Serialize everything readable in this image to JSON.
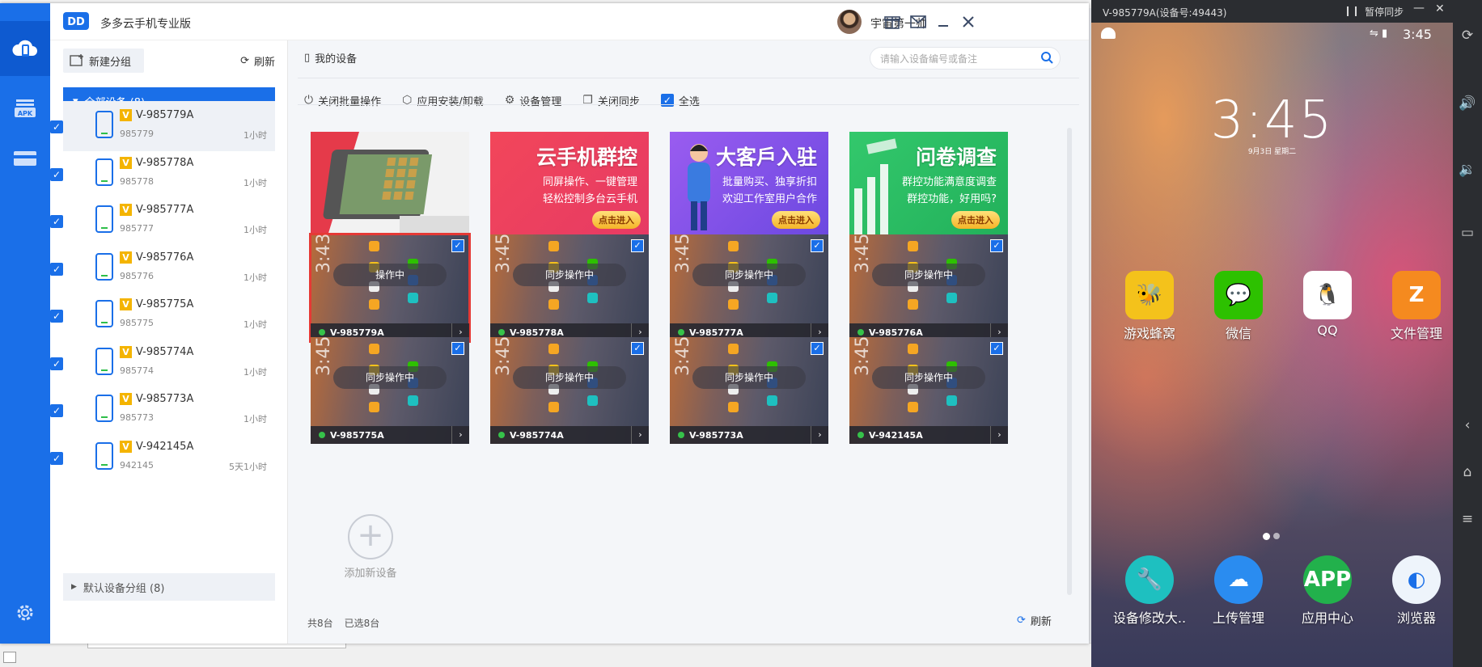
{
  "app": {
    "title": "多多云手机专业版",
    "user_name": "宇宙第一帅"
  },
  "groups": {
    "new_group_label": "新建分组",
    "refresh_label": "刷新",
    "all_devices_label": "全部设备 (8)",
    "default_group_label": "默认设备分组 (8)",
    "devices": [
      {
        "name": "V-985779A",
        "id": "985779",
        "time": "1小时"
      },
      {
        "name": "V-985778A",
        "id": "985778",
        "time": "1小时"
      },
      {
        "name": "V-985777A",
        "id": "985777",
        "time": "1小时"
      },
      {
        "name": "V-985776A",
        "id": "985776",
        "time": "1小时"
      },
      {
        "name": "V-985775A",
        "id": "985775",
        "time": "1小时"
      },
      {
        "name": "V-985774A",
        "id": "985774",
        "time": "1小时"
      },
      {
        "name": "V-985773A",
        "id": "985773",
        "time": "1小时"
      },
      {
        "name": "V-942145A",
        "id": "942145",
        "time": "5天1小时"
      }
    ],
    "badge": "V"
  },
  "main": {
    "header_label": "我的设备",
    "search_placeholder": "请输入设备编号或备注",
    "toolbar": {
      "close_batch": "关闭批量操作",
      "app_install": "应用安装/卸载",
      "device_manage": "设备管理",
      "close_sync": "关闭同步",
      "select_all": "全选"
    },
    "banners": [
      {
        "title": "",
        "sub1": "",
        "sub2": "",
        "button": ""
      },
      {
        "title": "云手机群控",
        "sub1": "同屏操作、一键管理",
        "sub2": "轻松控制多台云手机",
        "button": "点击进入"
      },
      {
        "title": "大客戶入驻",
        "sub1": "批量购买、独享折扣",
        "sub2": "欢迎工作室用户合作",
        "button": "点击进入"
      },
      {
        "title": "问卷调查",
        "sub1": "群控功能满意度调查",
        "sub2": "群控功能，好用吗?",
        "button": "点击进入"
      }
    ],
    "screens": [
      {
        "name": "V-985779A",
        "status": "操作中",
        "clock": "3:43"
      },
      {
        "name": "V-985778A",
        "status": "同步操作中",
        "clock": "3:45"
      },
      {
        "name": "V-985777A",
        "status": "同步操作中",
        "clock": "3:45"
      },
      {
        "name": "V-985776A",
        "status": "同步操作中",
        "clock": "3:45"
      },
      {
        "name": "V-985775A",
        "status": "同步操作中",
        "clock": "3:45"
      },
      {
        "name": "V-985774A",
        "status": "同步操作中",
        "clock": "3:45"
      },
      {
        "name": "V-985773A",
        "status": "同步操作中",
        "clock": "3:45"
      },
      {
        "name": "V-942145A",
        "status": "同步操作中",
        "clock": "3:45"
      }
    ],
    "add_device_label": "添加新设备",
    "footer_total": "共8台",
    "footer_selected": "已选8台",
    "footer_refresh": "刷新"
  },
  "preview": {
    "title": "V-985779A(设备号:49443)",
    "pause_label": "暂停同步",
    "status_time": "3:45",
    "clock": "3:45",
    "date": "9月3日 星期二",
    "apps_row1": [
      {
        "label": "游戏蜂窝",
        "color": "#f4c21b"
      },
      {
        "label": "微信",
        "color": "#2dc100"
      },
      {
        "label": "QQ",
        "color": "#ffffff"
      },
      {
        "label": "文件管理",
        "color": "#f58a1f"
      }
    ],
    "apps_row2": [
      {
        "label": "设备修改大..",
        "color": "#1ec0c0"
      },
      {
        "label": "上传管理",
        "color": "#2a8cf0"
      },
      {
        "label": "应用中心",
        "color": "#22b14c"
      },
      {
        "label": "浏览器",
        "color": "#eef4fb"
      }
    ]
  },
  "colors": {
    "brand": "#1a6fe8",
    "selected_outline": "#e53935",
    "online": "#36c24a"
  }
}
